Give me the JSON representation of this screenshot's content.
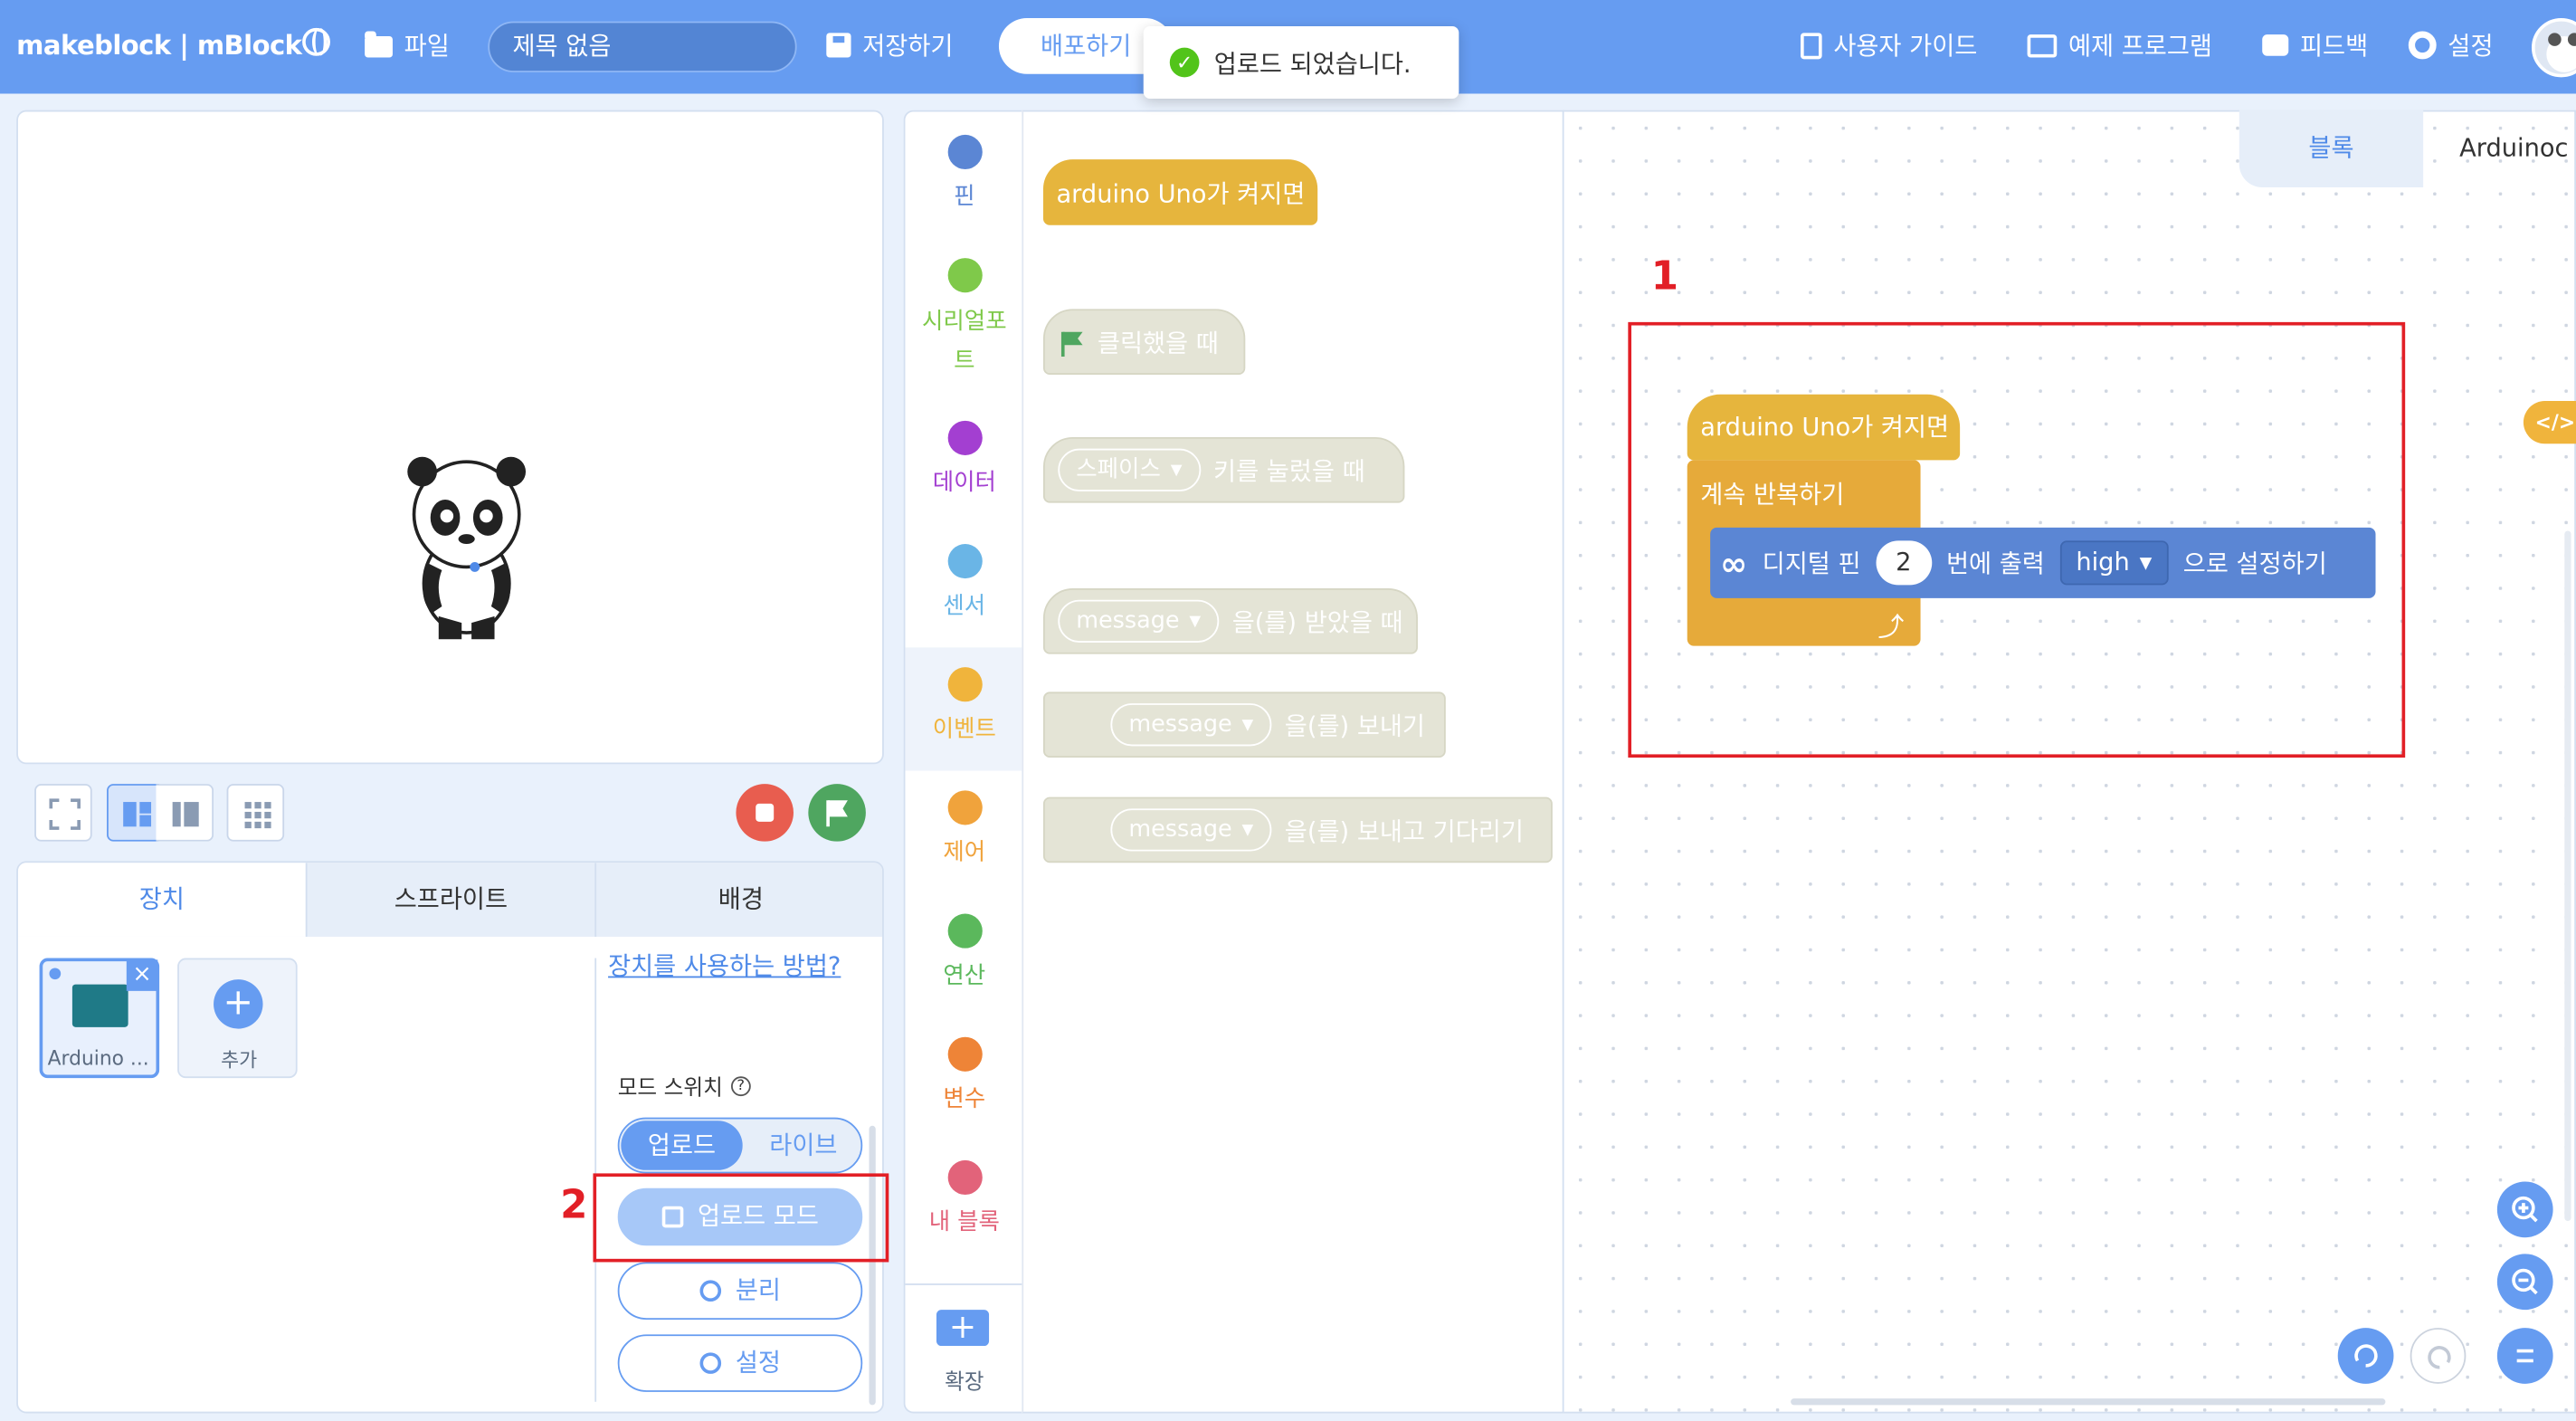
{
  "header": {
    "logo": "makeblock | mBlock",
    "file_label": "파일",
    "project_title": "제목 없음",
    "save_label": "저장하기",
    "deploy_label": "배포하기",
    "toast_message": "업로드 되었습니다.",
    "user_guide_label": "사용자 가이드",
    "examples_label": "예제 프로그램",
    "feedback_label": "피드백",
    "settings_label": "설정"
  },
  "device_panel": {
    "tabs": [
      {
        "label": "장치",
        "active": true
      },
      {
        "label": "스프라이트",
        "active": false
      },
      {
        "label": "배경",
        "active": false
      }
    ],
    "device_label": "Arduino ...",
    "add_label": "추가",
    "howto_link": "장치를 사용하는 방법?",
    "mode_switch_label": "모드 스위치",
    "mode_upload": "업로드",
    "mode_live": "라이브",
    "upload_mode_button": "업로드 모드",
    "disconnect_button": "분리",
    "settings_button": "설정"
  },
  "categories": [
    {
      "label": "핀",
      "color": "#5b86d4"
    },
    {
      "label": "시리얼포트",
      "color": "#7fc94a"
    },
    {
      "label": "데이터",
      "color": "#a33fd1"
    },
    {
      "label": "센서",
      "color": "#6ab5e6"
    },
    {
      "label": "이벤트",
      "color": "#f0b43c",
      "active": true
    },
    {
      "label": "제어",
      "color": "#f0a33c"
    },
    {
      "label": "연산",
      "color": "#5bb85c"
    },
    {
      "label": "변수",
      "color": "#ee8437"
    },
    {
      "label": "내 블록",
      "color": "#e2637a"
    }
  ],
  "extension_label": "확장",
  "palette": {
    "when_board_on": "arduino Uno가 켜지면",
    "when_flag_clicked": "클릭했을 때",
    "space_key_dropdown": "스페이스",
    "when_key_pressed": "키를 눌렀을 때",
    "message_dropdown": "message",
    "when_received": "을(를) 받았을 때",
    "broadcast": "을(를) 보내기",
    "broadcast_wait": "을(를) 보내고 기다리기"
  },
  "workspace": {
    "tab_blocks": "블록",
    "tab_code": "Arduinoc",
    "code_toggle": "</>",
    "script": {
      "hat": "arduino Uno가 켜지면",
      "forever": "계속 반복하기",
      "digital_pin_label": "디지털 핀",
      "pin_value": "2",
      "output_label": "번에 출력",
      "level_value": "high",
      "set_label": "으로 설정하기"
    }
  },
  "annotations": {
    "box1_label": "1",
    "box2_label": "2"
  },
  "colors": {
    "header_blue": "#669cf1",
    "event_yellow": "#e6b53d",
    "pin_blue": "#5b86d4",
    "annotation_red": "#e21f26"
  }
}
